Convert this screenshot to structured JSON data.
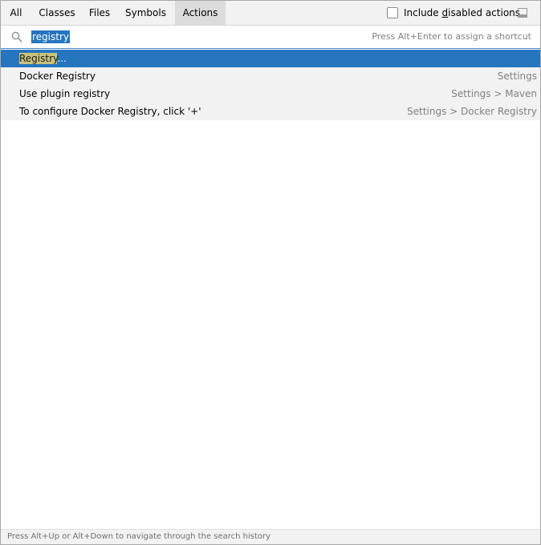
{
  "tabs": {
    "all": "All",
    "classes": "Classes",
    "files": "Files",
    "symbols": "Symbols",
    "actions": "Actions",
    "active": "Actions"
  },
  "toolbar": {
    "include_disabled_label_pre": "Include ",
    "include_disabled_label_mnemonic": "d",
    "include_disabled_label_post": "isabled actions",
    "include_disabled_checked": false,
    "pin_icon": "pin-window-icon"
  },
  "search": {
    "icon": "search-icon",
    "value": "registry",
    "hint": "Press Alt+Enter to assign a shortcut"
  },
  "results": [
    {
      "match": "Registry",
      "rest": "...",
      "location": "",
      "selected": true
    },
    {
      "match": "",
      "rest": "Docker Registry",
      "location": "Settings",
      "selected": false
    },
    {
      "match": "",
      "rest": "Use plugin registry",
      "location": "Settings > Maven",
      "selected": false
    },
    {
      "match": "",
      "rest": "To configure Docker Registry, click '+'",
      "location": "Settings > Docker Registry",
      "selected": false
    }
  ],
  "status": {
    "text": "Press Alt+Up or Alt+Down to navigate through the search history"
  },
  "colors": {
    "selection": "#2675bf",
    "match_highlight": "#c8c27e",
    "tabbar_bg": "#f2f2f2",
    "active_tab_bg": "#dcdcdc"
  }
}
